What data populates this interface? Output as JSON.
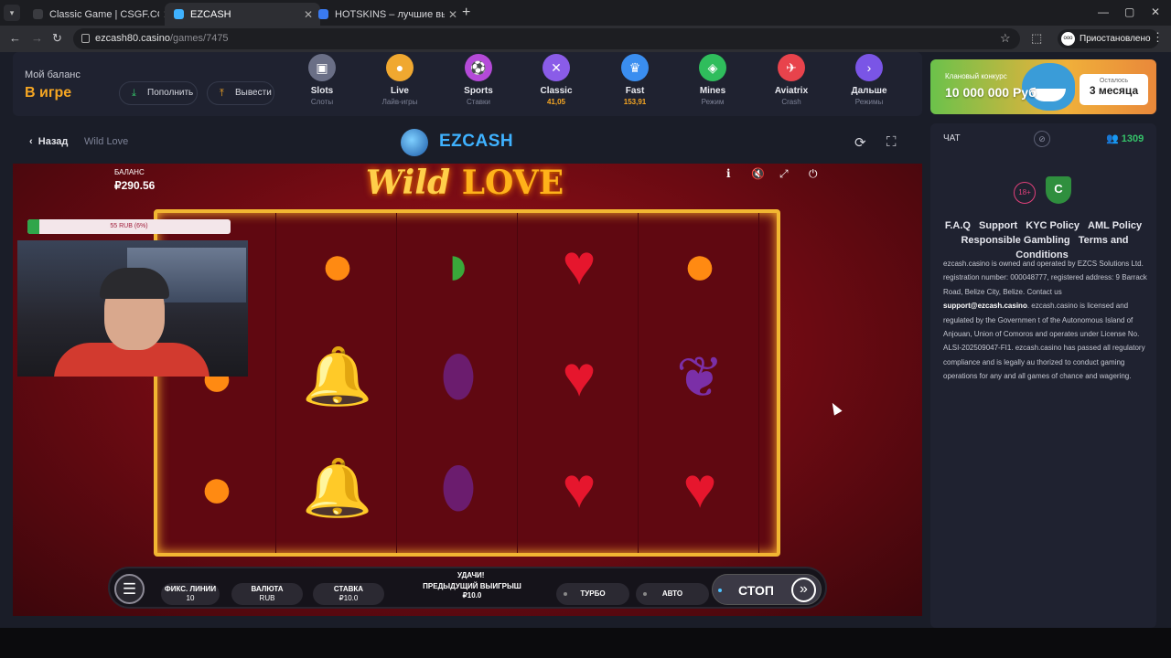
{
  "browser": {
    "tabs": [
      {
        "title": "Classic Game | CSGF.CC",
        "active": false
      },
      {
        "title": "EZCASH",
        "active": true
      },
      {
        "title": "HOTSKINS – лучшие выигрыш",
        "active": false
      }
    ],
    "url_host": "ezcash80.casino",
    "url_path": "/games/7475",
    "profile_label": "Приостановлено",
    "profile_avatar": "ooo",
    "icons": {
      "new_tab": "+",
      "minimize": "—",
      "maximize": "▢",
      "close": "✕",
      "back": "←",
      "forward": "→",
      "reload": "↻",
      "bookmark": "☆",
      "extensions": "⬚",
      "menu": "⋮"
    }
  },
  "balance": {
    "label": "Мой баланс",
    "value": "В игре",
    "deposit_button": "Пополнить",
    "withdraw_button": "Вывести"
  },
  "nav": [
    {
      "label": "Slots",
      "sub": "Слоты",
      "color": "#6a6f86",
      "icon": "▣"
    },
    {
      "label": "Live",
      "sub": "Лайв-игры",
      "color": "#f0a830",
      "icon": "●"
    },
    {
      "label": "Sports",
      "sub": "Ставки",
      "color": "#b44ad8",
      "icon": "⚽"
    },
    {
      "label": "Classic",
      "sub": "41,05",
      "color": "#8a5ce8",
      "icon": "✕"
    },
    {
      "label": "Fast",
      "sub": "153,91",
      "color": "#3a8ef0",
      "icon": "♛"
    },
    {
      "label": "Mines",
      "sub": "Режим",
      "color": "#2fbd5c",
      "icon": "◈"
    },
    {
      "label": "Aviatrix",
      "sub": "Crash",
      "color": "#e8434c",
      "icon": "✈"
    },
    {
      "label": "Дальше",
      "sub": "Режимы",
      "color": "#7a55e6",
      "icon": "›"
    }
  ],
  "promo": {
    "line1": "Клановый конкурс",
    "line2": "10 000 000 Руб",
    "box_top": "Осталось",
    "box_main": "3 месяца"
  },
  "game_header": {
    "back": "Назад",
    "game_name": "Wild Love",
    "brand": "EZCASH",
    "icons": {
      "reload": "⟳",
      "fullscreen": "⛶"
    }
  },
  "game": {
    "balance_label": "БАЛАНС",
    "balance_value": "₽290.56",
    "title_wild": "Wild",
    "title_love": "LOVE",
    "icons": {
      "info": "i",
      "mute": "🔇",
      "expand": "⤢",
      "power": "⏻"
    },
    "progress_text": "55 RUB (6%)",
    "progress_fraction": 0.06,
    "reels": [
      [
        "orange",
        "orange",
        "orange"
      ],
      [
        "orange",
        "bell",
        "bell"
      ],
      [
        "melon",
        "plum",
        "plum"
      ],
      [
        "cherry",
        "cherry",
        "cherry"
      ],
      [
        "orange",
        "grape",
        "cherry"
      ]
    ],
    "symbol_glyphs": {
      "orange": "●",
      "cherry": "♥",
      "plum": "⬮",
      "bell": "🔔",
      "melon": "◗",
      "grape": "❦"
    },
    "bar": {
      "top_text": "УДАЧИ!",
      "lines_label": "ФИКС. ЛИНИИ",
      "lines_value": "10",
      "currency_label": "ВАЛЮТА",
      "currency_value": "RUB",
      "bet_label": "СТАВКА",
      "bet_value": "₽10.0",
      "prev_win_label": "ПРЕДЫДУЩИЙ ВЫИГРЫШ",
      "prev_win_value": "₽10.0",
      "turbo": "ТУРБО",
      "auto": "АВТО",
      "stop": "СТОП",
      "hamburger": "☰",
      "arrows": "»"
    }
  },
  "side": {
    "chat_label": "ЧАТ",
    "online_count": "1309",
    "online_icon": "👥",
    "age_badge": "18+",
    "shield_glyph": "C",
    "links": [
      "F.A.Q",
      "Support",
      "KYC Policy",
      "AML Policy",
      "Responsible Gambling",
      "Terms and Conditions"
    ],
    "legal_1": "ezcash.casino is owned and operated by EZCS Solutions Ltd. registration number: 000048777, registered address: 9 Barrack Road, Belize City, Belize. Contact us",
    "legal_email": "support@ezcash.casino",
    "legal_2": ". ezcash.casino is licensed and regulated by the Governmen t of the Autonomous Island of Anjouan, Union of Comoros and operates under License No. ALSI-202509047-FI1. ezcash.casino has passed all regulatory compliance and is legally au thorized to conduct gaming operations for any and all games of chance and wagering."
  }
}
